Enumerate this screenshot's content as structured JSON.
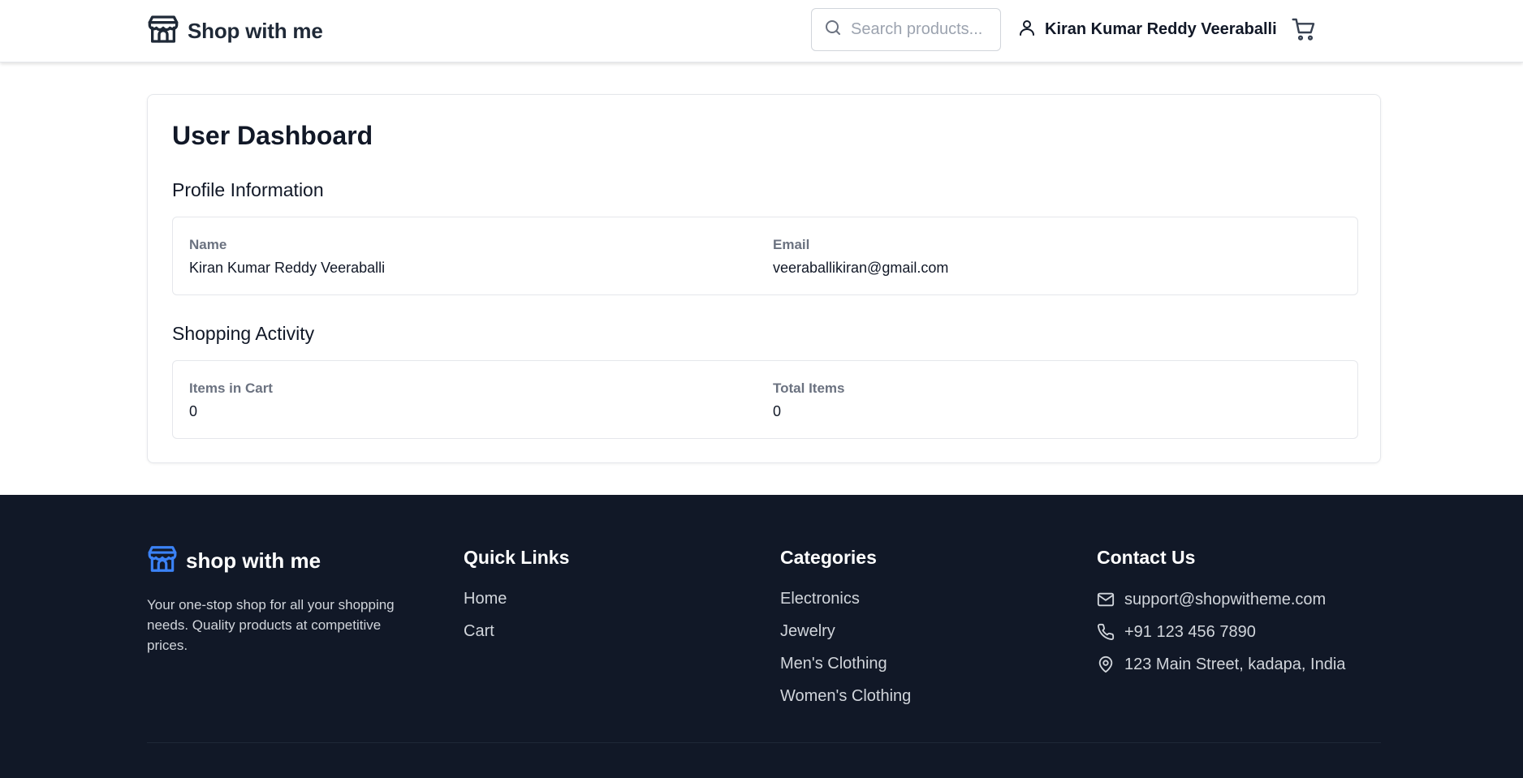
{
  "header": {
    "brand": "Shop with me",
    "search_placeholder": "Search products...",
    "user_name": "Kiran Kumar Reddy Veeraballi"
  },
  "dashboard": {
    "title": "User Dashboard",
    "profile": {
      "heading": "Profile Information",
      "name_label": "Name",
      "name_value": "Kiran Kumar Reddy Veeraballi",
      "email_label": "Email",
      "email_value": "veeraballikiran@gmail.com"
    },
    "activity": {
      "heading": "Shopping Activity",
      "cart_label": "Items in Cart",
      "cart_value": "0",
      "total_label": "Total Items",
      "total_value": "0"
    }
  },
  "footer": {
    "brand": "shop with me",
    "description": "Your one-stop shop for all your shopping needs. Quality products at competitive prices.",
    "quick_links": {
      "heading": "Quick Links",
      "items": [
        "Home",
        "Cart"
      ]
    },
    "categories": {
      "heading": "Categories",
      "items": [
        "Electronics",
        "Jewelry",
        "Men's Clothing",
        "Women's Clothing"
      ]
    },
    "contact": {
      "heading": "Contact Us",
      "email": "support@shopwitheme.com",
      "phone": "+91 123 456 7890",
      "address": "123 Main Street, kadapa, India"
    }
  },
  "colors": {
    "footer_bg": "#111827",
    "brand_icon_footer": "#3b82f6",
    "text_dark": "#111827",
    "muted": "#6b7280"
  },
  "icons": [
    "store-icon",
    "search-icon",
    "user-icon",
    "cart-icon",
    "mail-icon",
    "phone-icon",
    "map-pin-icon"
  ]
}
